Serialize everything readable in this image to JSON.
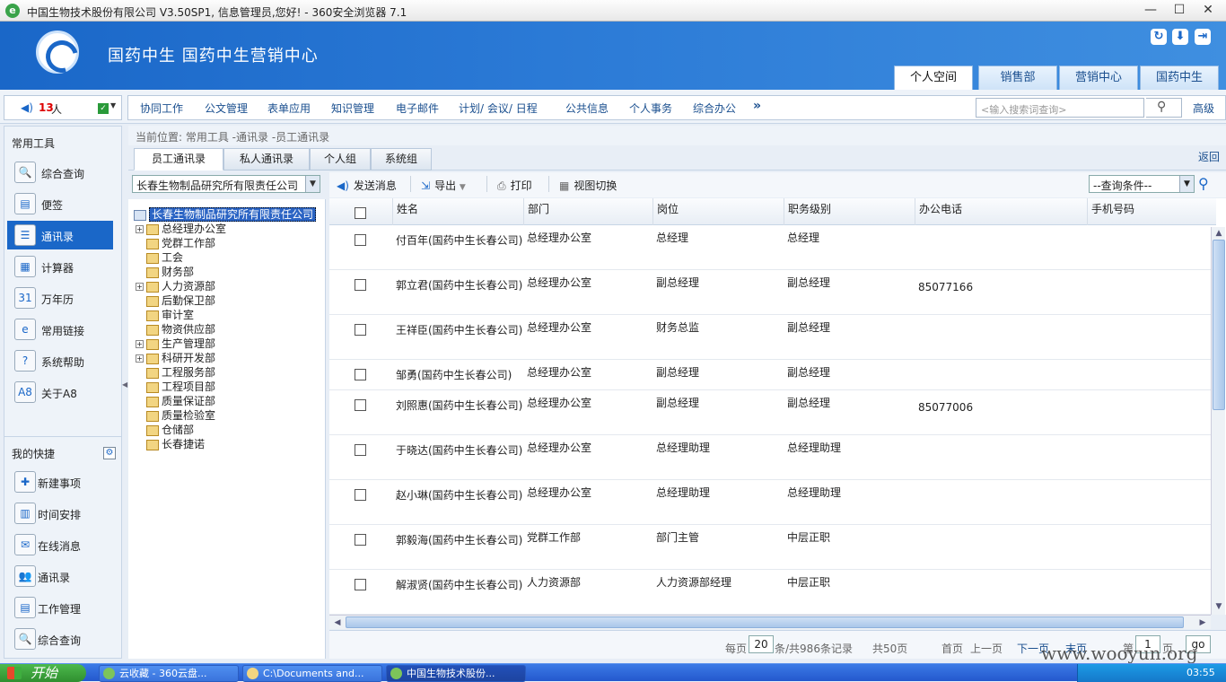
{
  "window": {
    "title": "中国生物技术股份有限公司 V3.50SP1, 信息管理员,您好! - 360安全浏览器 7.1",
    "controls": [
      "—",
      "☐",
      "✕"
    ]
  },
  "header": {
    "system_name": "国药中生 国药中生营销中心",
    "space_tabs": [
      "个人空间",
      "销售部",
      "营销中心",
      "国药中生"
    ]
  },
  "online": {
    "count": "13",
    "unit": "人"
  },
  "menu": {
    "items": [
      "协同工作",
      "公文管理",
      "表单应用",
      "知识管理",
      "电子邮件",
      "计划/ 会议/ 日程",
      "公共信息",
      "个人事务",
      "综合办公"
    ],
    "more": "»",
    "search_placeholder": "<输入搜索词查询>",
    "advanced": "高级"
  },
  "sidebar": {
    "common_tools_title": "常用工具",
    "common_tools": [
      {
        "label": "综合查询",
        "icon": "search-doc-icon",
        "glyph": "🔍"
      },
      {
        "label": "便签",
        "icon": "note-icon",
        "glyph": "▤"
      },
      {
        "label": "通讯录",
        "icon": "contacts-icon",
        "glyph": "☰"
      },
      {
        "label": "计算器",
        "icon": "calculator-icon",
        "glyph": "▦"
      },
      {
        "label": "万年历",
        "icon": "calendar-icon",
        "glyph": "31"
      },
      {
        "label": "常用链接",
        "icon": "link-icon",
        "glyph": "e"
      },
      {
        "label": "系统帮助",
        "icon": "help-icon",
        "glyph": "?"
      },
      {
        "label": "关于A8",
        "icon": "about-icon",
        "glyph": "A8"
      }
    ],
    "shortcuts_title": "我的快捷",
    "shortcuts": [
      {
        "label": "新建事项",
        "icon": "new-item-icon",
        "glyph": "✚"
      },
      {
        "label": "时间安排",
        "icon": "schedule-icon",
        "glyph": "▥"
      },
      {
        "label": "在线消息",
        "icon": "message-icon",
        "glyph": "✉"
      },
      {
        "label": "通讯录",
        "icon": "contacts-icon",
        "glyph": "👥"
      },
      {
        "label": "工作管理",
        "icon": "work-manage-icon",
        "glyph": "▤"
      },
      {
        "label": "综合查询",
        "icon": "search-doc-icon",
        "glyph": "🔍"
      }
    ]
  },
  "breadcrumb": "当前位置: 常用工具 -通讯录 -员工通讯录",
  "content_tabs": [
    "员工通讯录",
    "私人通讯录",
    "个人组",
    "系统组"
  ],
  "back_label": "返回",
  "org_select": "长春生物制品研究所有限责任公司",
  "tree": {
    "root": "长春生物制品研究所有限责任公司",
    "nodes": [
      {
        "label": "总经理办公室",
        "expandable": true
      },
      {
        "label": "党群工作部",
        "expandable": false
      },
      {
        "label": "工会",
        "expandable": false
      },
      {
        "label": "财务部",
        "expandable": false
      },
      {
        "label": "人力资源部",
        "expandable": true
      },
      {
        "label": "后勤保卫部",
        "expandable": false
      },
      {
        "label": "审计室",
        "expandable": false
      },
      {
        "label": "物资供应部",
        "expandable": false
      },
      {
        "label": "生产管理部",
        "expandable": true
      },
      {
        "label": "科研开发部",
        "expandable": true
      },
      {
        "label": "工程服务部",
        "expandable": false
      },
      {
        "label": "工程项目部",
        "expandable": false
      },
      {
        "label": "质量保证部",
        "expandable": false
      },
      {
        "label": "质量检验室",
        "expandable": false
      },
      {
        "label": "仓储部",
        "expandable": false
      },
      {
        "label": "长春捷诺",
        "expandable": false
      }
    ]
  },
  "toolbar": {
    "send_message": "发送消息",
    "export": "导出",
    "print": "打印",
    "view_switch": "视图切换",
    "query_condition": "--查询条件--"
  },
  "grid": {
    "columns": [
      "姓名",
      "部门",
      "岗位",
      "职务级别",
      "办公电话",
      "手机号码"
    ],
    "rows": [
      [
        "付百年(国药中生长春公司)",
        "总经理办公室",
        "总经理",
        "总经理",
        "",
        ""
      ],
      [
        "郭立君(国药中生长春公司)",
        "总经理办公室",
        "副总经理",
        "副总经理",
        "85077166",
        ""
      ],
      [
        "王祥臣(国药中生长春公司)",
        "总经理办公室",
        "财务总监",
        "副总经理",
        "",
        ""
      ],
      [
        "邹勇(国药中生长春公司)",
        "总经理办公室",
        "副总经理",
        "副总经理",
        "",
        ""
      ],
      [
        "刘照惠(国药中生长春公司)",
        "总经理办公室",
        "副总经理",
        "副总经理",
        "85077006",
        ""
      ],
      [
        "于晓达(国药中生长春公司)",
        "总经理办公室",
        "总经理助理",
        "总经理助理",
        "",
        ""
      ],
      [
        "赵小琳(国药中生长春公司)",
        "总经理办公室",
        "总经理助理",
        "总经理助理",
        "",
        ""
      ],
      [
        "郭毅海(国药中生长春公司)",
        "党群工作部",
        "部门主管",
        "中层正职",
        "",
        ""
      ],
      [
        "解淑贤(国药中生长春公司)",
        "人力资源部",
        "人力资源部经理",
        "中层正职",
        "",
        ""
      ]
    ]
  },
  "pager": {
    "per_page_label": "每页",
    "per_page": "20",
    "total_label": "条/共986条记录",
    "pages_label": "共50页",
    "first": "首页",
    "prev": "上一页",
    "next": "下一页",
    "last": "末页",
    "page_prefix": "第",
    "current_page": "1",
    "page_suffix": "页",
    "go": "go"
  },
  "taskbar": {
    "start": "开始",
    "tasks": [
      "云收藏 - 360云盘...",
      "C:\\Documents and...",
      "中国生物技术股份..."
    ],
    "clock": "03:55"
  },
  "watermark": "www.wooyun.org",
  "colors": {
    "brand_blue": "#1a67c8",
    "link_blue": "#1a4f8f",
    "selected_bg": "#1a67c8"
  }
}
